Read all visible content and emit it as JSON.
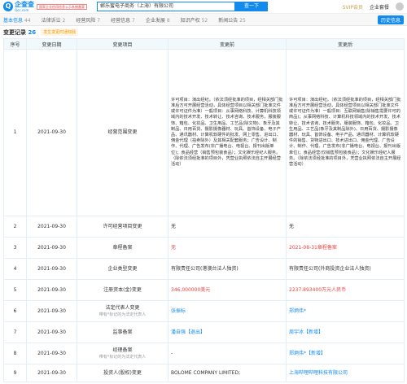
{
  "header": {
    "logo_text": "企查查",
    "logo_sub": "Qcc.com",
    "badge": "国家企业信用信息公示系统备案",
    "search_value": "郸乐蜜电子商务（上海）有限公司",
    "search_button": "查一下",
    "svip": "SVIP会员",
    "enterprise": "企业套餐",
    "user": "用户"
  },
  "nav": {
    "items": [
      {
        "label": "基本信息",
        "count": "44"
      },
      {
        "label": "法律诉讼",
        "count": "2"
      },
      {
        "label": "经营风险",
        "count": "7"
      },
      {
        "label": "经营信息",
        "count": "7"
      },
      {
        "label": "企业发展",
        "count": "8"
      },
      {
        "label": "知识产权",
        "count": "52"
      },
      {
        "label": "新闻公告",
        "count": "25"
      }
    ],
    "history": "历史信息"
  },
  "section": {
    "title": "变更记录",
    "count": "26",
    "warn": "发生变更时通知我"
  },
  "table": {
    "headers": [
      "序号",
      "变更日期",
      "变更项目",
      "变更前",
      "变更后"
    ],
    "rows": [
      {
        "no": "1",
        "date": "2021-09-30",
        "item": "经营范围变更",
        "before": "许可项目：演出经纪。（依法须经批准的项目，经相关部门批准后方可开展经营活动，具体经营项目以相关部门批准文件或许可证件为准）一般项目：从事网络科技、计算机科技领域内的技术开发、技术转让、技术咨询、技术服务，服装服饰、箱包、化妆品、卫生用品、工艺品(除文物)、象牙及其制品、日用百货、摄影摄像器材、玩具、首饰设备、电子产品、通讯器材、计算机软硬件的批发、网上零售、进出口、佣金代理（拍卖除外）及其相关配套服务；广告设计、制作、代理、广告发布(非广播电台、电视台、报刊出版单位)；食品经营（销售预包装食品）；文化娱乐经纪人服务。（除依法须经批准的项目外，凭营业执照依法自主开展经营活动）",
        "after": "许可项目：演出经纪。（依法须经批准的项目，经相关部门批准后方可开展经营活动，具体经营项目以相关部门批准文件或许可证件为准）一般项目：互联网销售(除销售需要许可的商品)；从事网络科技、计算机科技领域内的技术开发、技术转让、技术咨询、技术服务，服装服饰、箱包、化妆品、卫生用品、工艺品(象牙及其制品除外)、日用百货、摄影摄像器材、玩具、首饰设备、电子产品、通讯器材、计算机软硬件的销售、货物进出口、技术进出口、佣金代理、广告设计、制作、代理、广告发布(非广播电台、电视台、报刊出版单位)；食品经营(仅销售预包装食品)；文化娱乐经纪人服务。（除依法须经批准的项目外，凭营业执照依法自主开展经营活动）"
      },
      {
        "no": "2",
        "date": "2021-09-30",
        "item": "许可经营项目变更",
        "before": "无",
        "after": "无"
      },
      {
        "no": "3",
        "date": "2021-09-30",
        "item": "章程备案",
        "before": "无",
        "after": "2021-08-31章程备案"
      },
      {
        "no": "4",
        "date": "2021-09-30",
        "item": "企业类型变更",
        "before": "有限责任公司(港澳台法人独资)",
        "after": "有限责任公司(外商投资企业法人独资)"
      },
      {
        "no": "5",
        "date": "2021-09-30",
        "item": "注册资本(金)变更",
        "before": "346,000000美元",
        "after": "2237.893400万元人民币"
      },
      {
        "no": "6",
        "date": "2021-09-30",
        "item": "法定代表人变更",
        "item_sub": "带有*标记的为法定代表人",
        "before": "张振标",
        "after": "郑炳伟*"
      },
      {
        "no": "7",
        "date": "2021-09-30",
        "item": "监事备案",
        "before": "潘自强【退出】",
        "after": "周宇冰【新增】"
      },
      {
        "no": "8",
        "date": "2021-09-30",
        "item": "经理备案",
        "item_sub": "带有*标记的为法定代表人",
        "before": "-",
        "after": "郑炳伟*【新增】"
      },
      {
        "no": "9",
        "date": "2021-09-30",
        "item": "投资人(股权)变更",
        "before": "BOLOME COMPANY LIMITED;",
        "after": "上海哔哩哔哩科技有限公司"
      }
    ]
  }
}
